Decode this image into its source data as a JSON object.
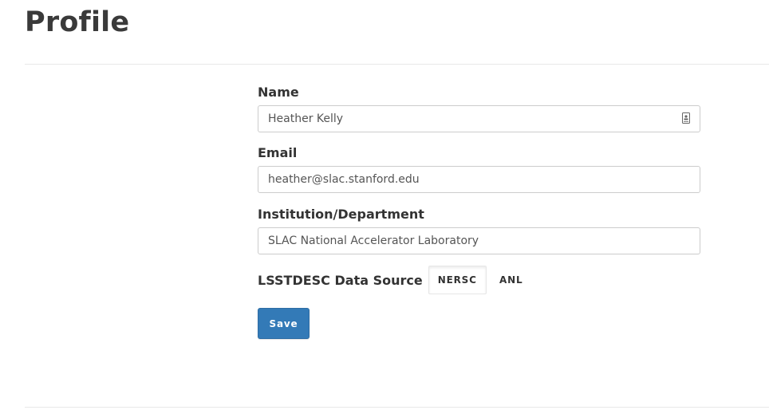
{
  "page": {
    "title": "Profile"
  },
  "form": {
    "name": {
      "label": "Name",
      "value": "Heather Kelly",
      "icon": "contact-card-icon"
    },
    "email": {
      "label": "Email",
      "value": "heather@slac.stanford.edu"
    },
    "institution": {
      "label": "Institution/Department",
      "value": "SLAC National Accelerator Laboratory"
    },
    "data_source": {
      "label": "LSSTDESC Data Source",
      "options": [
        "NERSC",
        "ANL"
      ],
      "selected": "NERSC"
    },
    "save_label": "Save"
  },
  "colors": {
    "primary_button": "#337ab7",
    "title_text": "#3a3a3a",
    "divider": "#e8e8e8"
  }
}
